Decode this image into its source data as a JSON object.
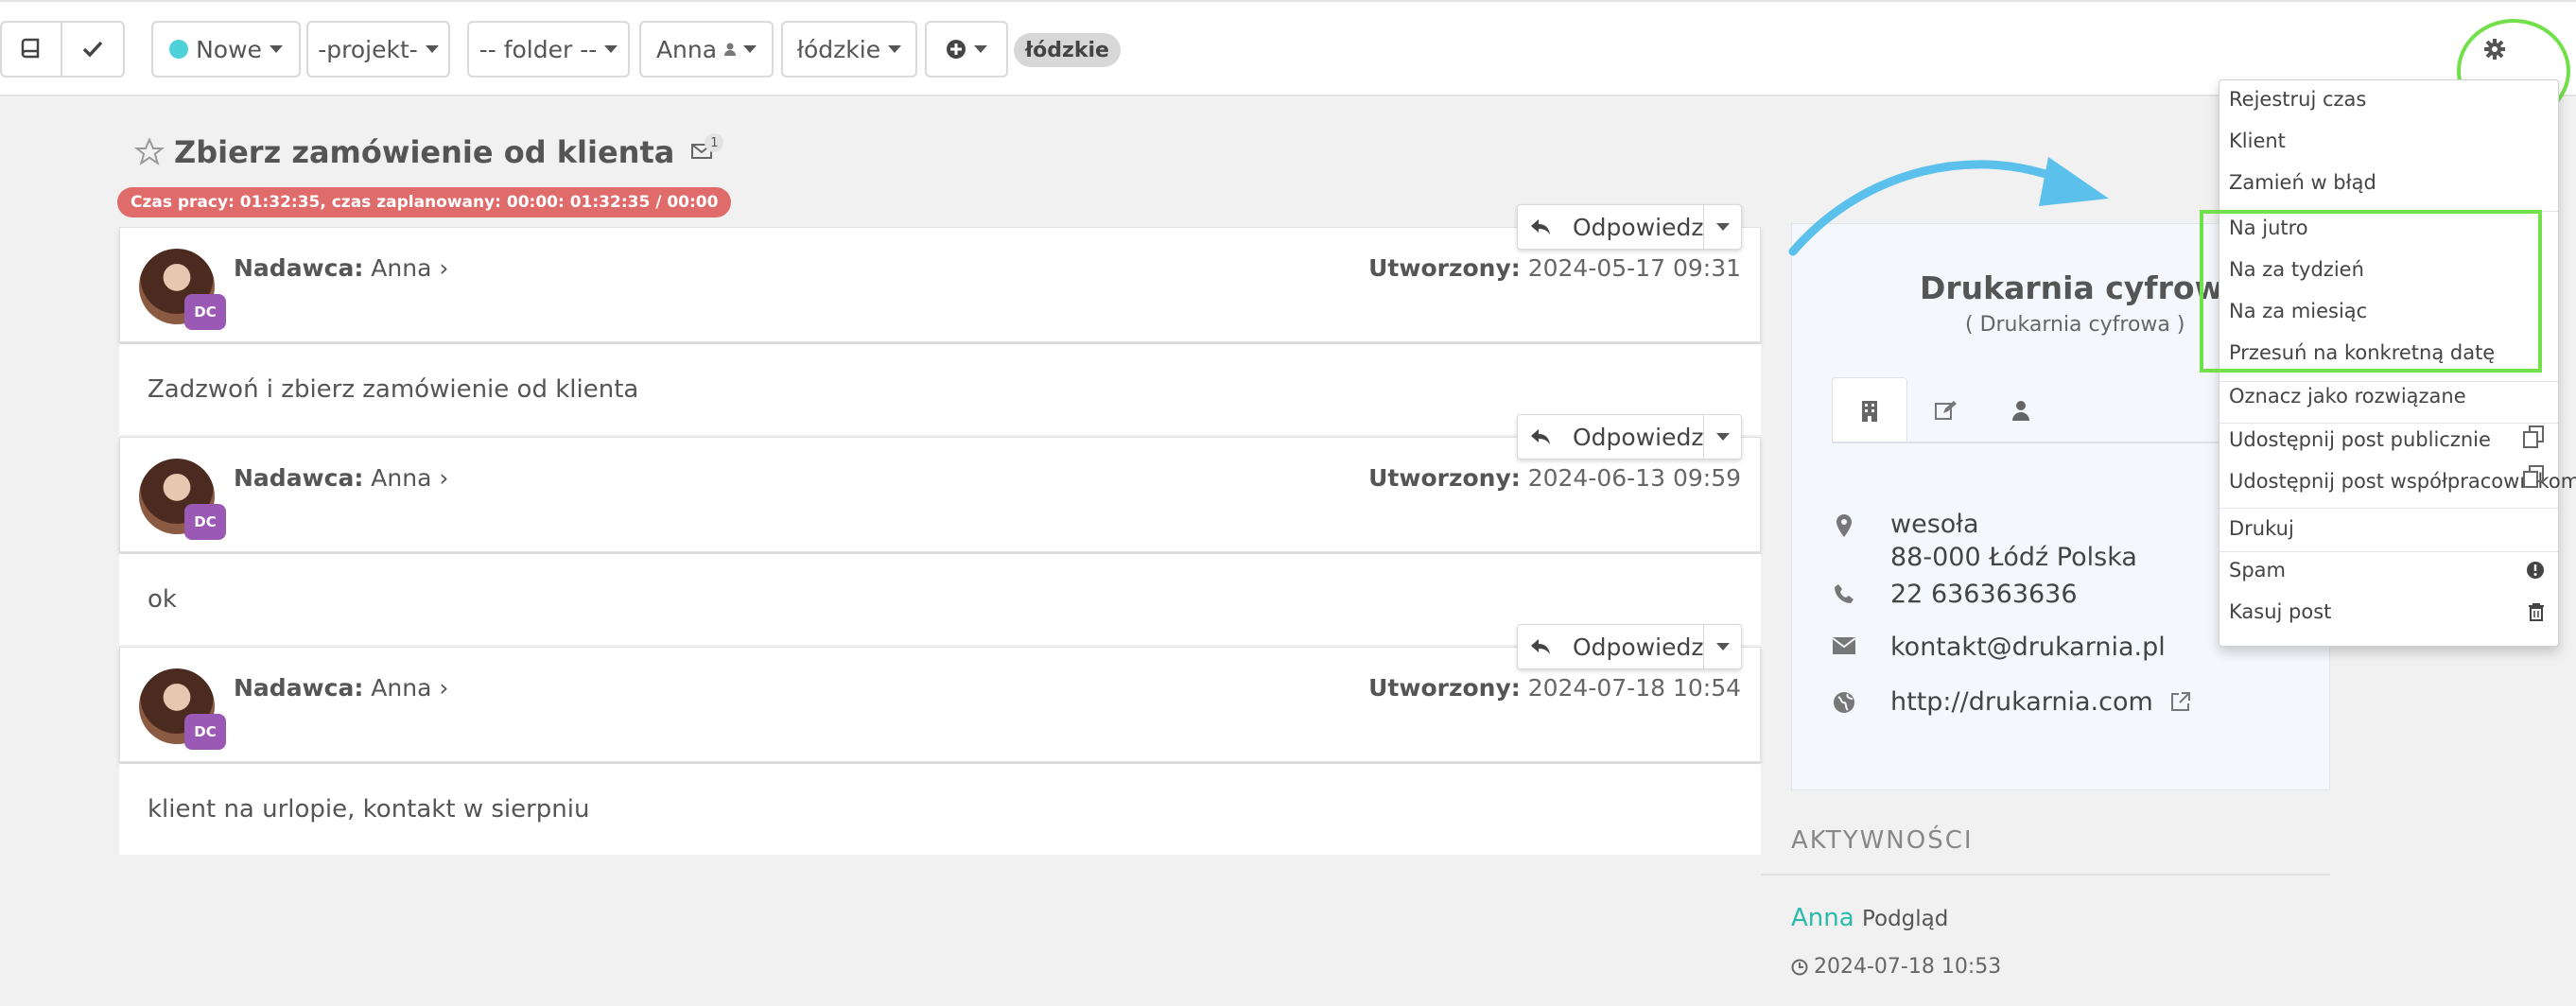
{
  "toolbar": {
    "book_icon": "book-icon",
    "check_icon": "check-icon",
    "status_label": "Nowe",
    "status_color": "#4fd1d9",
    "project_label": "-projekt-",
    "folder_label": "-- folder --",
    "user_label": "Anna",
    "region_label": "łódzkie",
    "tag_label": "łódzkie"
  },
  "post": {
    "title": "Zbierz zamówienie od klienta",
    "mail_count": "1",
    "work_time": "Czas pracy: 01:32:35, czas zaplanowany: 00:00: 01:32:35 / 00:00"
  },
  "messages": [
    {
      "sender_label": "Nadawca:",
      "sender": "Anna",
      "created_label": "Utworzony:",
      "created": "2024-05-17 09:31",
      "avatar_badge": "DC",
      "reply_label": "Odpowiedz",
      "body": "Zadzwoń i zbierz zamówienie od klienta"
    },
    {
      "sender_label": "Nadawca:",
      "sender": "Anna",
      "created_label": "Utworzony:",
      "created": "2024-06-13 09:59",
      "avatar_badge": "DC",
      "reply_label": "Odpowiedz",
      "body": "ok"
    },
    {
      "sender_label": "Nadawca:",
      "sender": "Anna",
      "created_label": "Utworzony:",
      "created": "2024-07-18 10:54",
      "avatar_badge": "DC",
      "reply_label": "Odpowiedz",
      "body": "klient na urlopie, kontakt w sierpniu"
    }
  ],
  "client": {
    "name": "Drukarnia cyfrowa",
    "subtitle": "( Drukarnia cyfrowa )",
    "street": "wesoła",
    "city": "88-000 Łódź Polska",
    "phone": "22 636363636",
    "email": "kontakt@drukarnia.pl",
    "website": "http://drukarnia.com"
  },
  "activity": {
    "title": "AKTYWNOŚCI",
    "user": "Anna",
    "action": "Podgląd",
    "time": "2024-07-18 10:53"
  },
  "menu": {
    "items": [
      "Rejestruj czas",
      "Klient",
      "Zamień w błąd",
      "Na jutro",
      "Na za tydzień",
      "Na za miesiąc",
      "Przesuń na konkretną datę",
      "Oznacz jako rozwiązane",
      "Udostępnij post publicznie",
      "Udostępnij post współpracownikom",
      "Drukuj",
      "Spam",
      "Kasuj post"
    ]
  },
  "colors": {
    "accent": "#2bbbad",
    "highlight": "#71e04a",
    "worktime_bg": "#e06b6b",
    "badge_bg": "#9b59b6",
    "arrow": "#5bc0eb"
  }
}
